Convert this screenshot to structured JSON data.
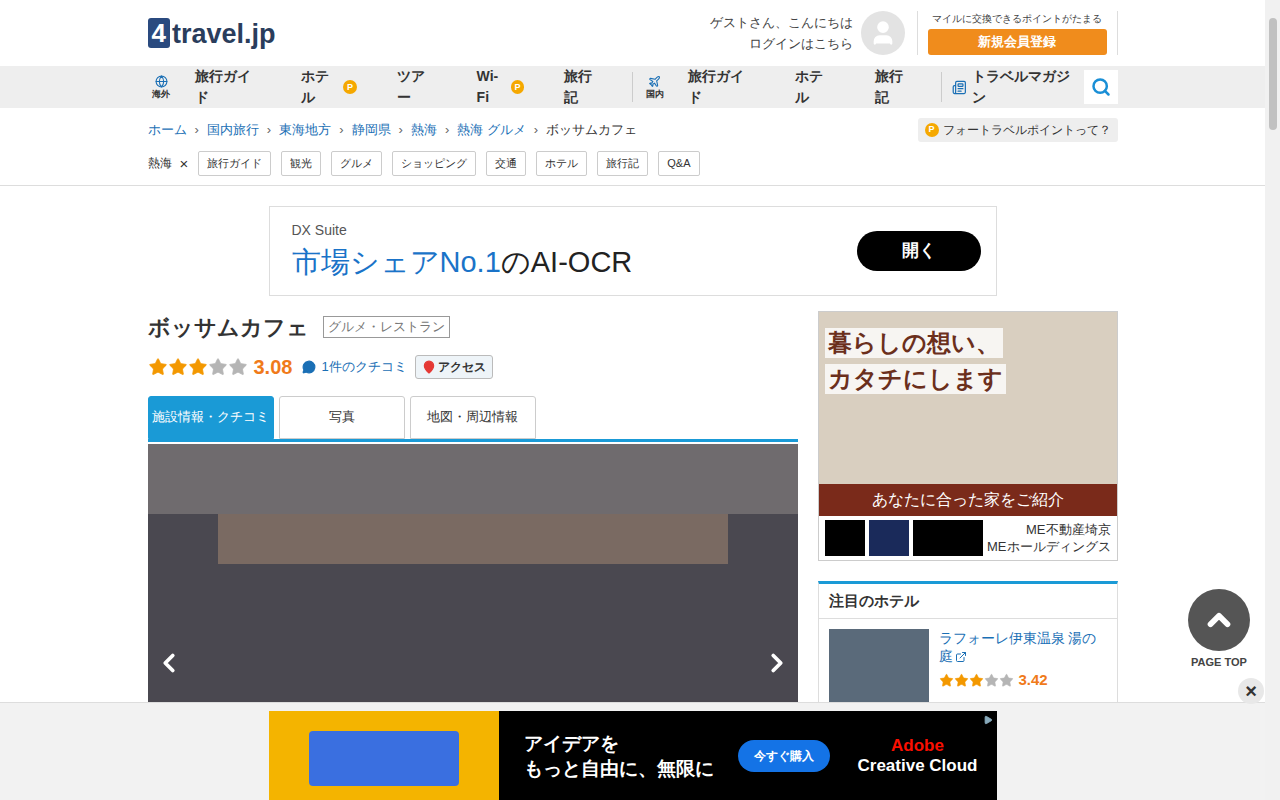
{
  "header": {
    "logo_mark": "4",
    "logo_text": "travel.jp",
    "greeting": "ゲストさん、こんにちは",
    "login": "ログインはこちら",
    "points_note": "マイルに交換できるポイントがたまる",
    "register": "新規会員登録"
  },
  "nav": {
    "overseas_label": "海外",
    "points_badge": "P",
    "overseas": [
      {
        "label": "旅行ガイド",
        "points": false
      },
      {
        "label": "ホテル",
        "points": true
      },
      {
        "label": "ツアー",
        "points": false
      },
      {
        "label": "Wi-Fi",
        "points": true
      },
      {
        "label": "旅行記",
        "points": false
      }
    ],
    "domestic_label": "国内",
    "domestic": [
      {
        "label": "旅行ガイド",
        "points": false
      },
      {
        "label": "ホテル",
        "points": false
      },
      {
        "label": "旅行記",
        "points": false
      }
    ],
    "magazine": "トラベルマガジン"
  },
  "breadcrumbs": [
    "ホーム",
    "国内旅行",
    "東海地方",
    "静岡県",
    "熱海",
    "熱海 グルメ",
    "ボッサムカフェ"
  ],
  "breadcrumb_separator": "›",
  "points_link": {
    "badge": "P",
    "label": "フォートラベルポイントって？"
  },
  "area_tags": {
    "area": "熱海",
    "clear": "×",
    "tags": [
      "旅行ガイド",
      "観光",
      "グルメ",
      "ショッピング",
      "交通",
      "ホテル",
      "旅行記",
      "Q&A"
    ]
  },
  "top_ad": {
    "brand": "DX Suite",
    "headline_blue": "市場シェアNo.1",
    "headline_rest": "のAI-OCR",
    "button": "開く"
  },
  "spot": {
    "name": "ボッサムカフェ",
    "category": "グルメ・レストラン",
    "stars": 3,
    "rating": "3.08",
    "reviews": "1件のクチコミ",
    "access": "アクセス"
  },
  "tabs": [
    {
      "label": "施設情報・クチコミ",
      "selected": true
    },
    {
      "label": "写真",
      "selected": false
    },
    {
      "label": "地図・周辺情報",
      "selected": false
    }
  ],
  "side_ad": {
    "headline": [
      "暮らしの想い、",
      "カタチにします"
    ],
    "sub": "あなたに合った家をご紹介",
    "company": [
      "ME不動産埼京",
      "MEホールディングス"
    ]
  },
  "featured_hotels": {
    "title": "注目のホテル",
    "items": [
      {
        "name": "ラフォーレ伊東温泉 湯の庭",
        "stars": 3,
        "rating": "3.42"
      }
    ]
  },
  "page_top": {
    "label": "PAGE TOP"
  },
  "bottom_ad": {
    "headline": [
      "アイデアを",
      "もっと自由に、無限に"
    ],
    "button": "今すぐ購入",
    "brand": [
      "Adobe",
      "Creative Cloud"
    ],
    "close": "×"
  }
}
